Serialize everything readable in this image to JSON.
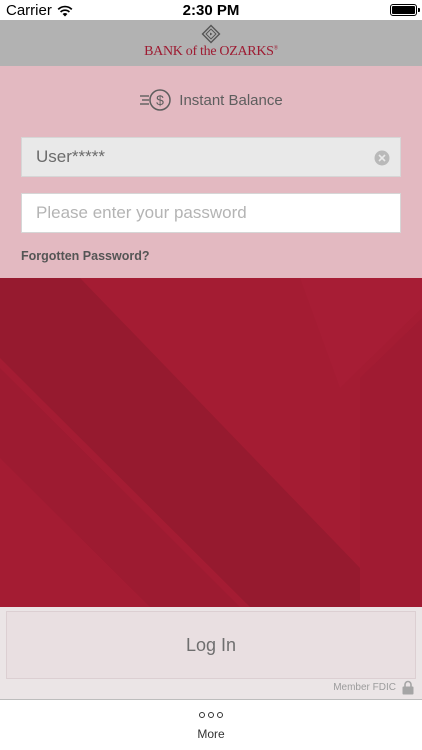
{
  "status_bar": {
    "carrier": "Carrier",
    "time": "2:30 PM",
    "icons": [
      "wifi-icon",
      "battery-icon"
    ]
  },
  "header": {
    "brand": "BANK of the OZARKS",
    "brand_mark": "®"
  },
  "login": {
    "instant_balance_label": "Instant Balance",
    "username_value": "User*****",
    "password_placeholder": "Please enter your password",
    "forgot_password": "Forgotten Password?"
  },
  "actions": {
    "login_button": "Log In",
    "fdic_label": "Member FDIC"
  },
  "tab_bar": {
    "more_label": "More"
  },
  "colors": {
    "brand": "#9e1b32",
    "panel": "#e3b9c1",
    "header": "#b2b2b2"
  }
}
